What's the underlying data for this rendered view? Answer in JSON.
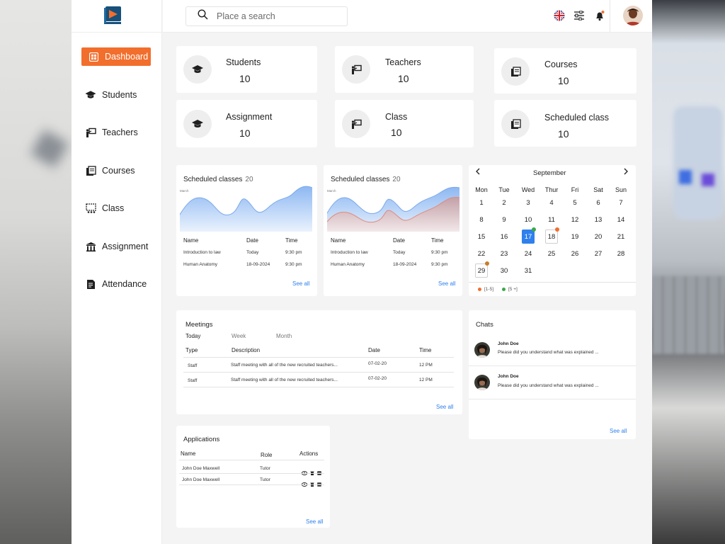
{
  "colors": {
    "accent": "#f26e2d",
    "link": "#2f80ed",
    "series_blue": "#8db8f2",
    "series_red": "#e2a39a"
  },
  "sidebar": {
    "items": [
      {
        "label": "Dashboard",
        "icon": "grid-icon",
        "active": true
      },
      {
        "label": "Students",
        "icon": "graduation-cap-icon"
      },
      {
        "label": "Teachers",
        "icon": "teacher-board-icon"
      },
      {
        "label": "Courses",
        "icon": "books-icon"
      },
      {
        "label": "Class",
        "icon": "classroom-icon"
      },
      {
        "label": "Assignment",
        "icon": "building-icon"
      },
      {
        "label": "Attendance",
        "icon": "document-icon"
      }
    ]
  },
  "topbar": {
    "search_placeholder": "Place a search",
    "icons": [
      "uk-flag-icon",
      "sliders-icon",
      "bell-icon",
      "user-avatar"
    ]
  },
  "stats": [
    {
      "label": "Students",
      "value": "10",
      "icon": "graduation-cap-icon"
    },
    {
      "label": "Teachers",
      "value": "10",
      "icon": "teacher-board-icon"
    },
    {
      "label": "Courses",
      "value": "10",
      "icon": "books-icon"
    },
    {
      "label": "Assignment",
      "value": "10",
      "icon": "graduation-cap-icon"
    },
    {
      "label": "Class",
      "value": "10",
      "icon": "teacher-board-icon"
    },
    {
      "label": "Scheduled class",
      "value": "10",
      "icon": "books-icon"
    }
  ],
  "scheduled": [
    {
      "title": "Scheduled classes",
      "count": "20",
      "month": "March",
      "headers": [
        "Name",
        "Date",
        "Time"
      ],
      "rows": [
        [
          "Introduction to law",
          "Today",
          "9:30 pm"
        ],
        [
          "Human Anatomy",
          "18-09-2024",
          "9:30 pm"
        ]
      ],
      "see_all": "See all"
    },
    {
      "title": "Scheduled classes",
      "count": "20",
      "month": "March",
      "headers": [
        "Name",
        "Date",
        "Time"
      ],
      "rows": [
        [
          "Introduction to law",
          "Today",
          "9:30 pm"
        ],
        [
          "Human Anatomy",
          "18-09-2024",
          "9:30 pm"
        ]
      ],
      "see_all": "See all"
    }
  ],
  "calendar": {
    "month": "September",
    "dow": [
      "Mon",
      "Tue",
      "Wed",
      "Thur",
      "Fri",
      "Sat",
      "Sun"
    ],
    "weeks": [
      [
        "1",
        "2",
        "3",
        "4",
        "5",
        "6",
        "7"
      ],
      [
        "8",
        "9",
        "10",
        "11",
        "12",
        "13",
        "14"
      ],
      [
        "15",
        "16",
        "17",
        "18",
        "19",
        "20",
        "21"
      ],
      [
        "22",
        "23",
        "24",
        "25",
        "26",
        "27",
        "28"
      ],
      [
        "29",
        "30",
        "31",
        "",
        "",
        "",
        ""
      ]
    ],
    "today": "17",
    "marked": [
      "18",
      "29"
    ],
    "legend": [
      {
        "label": "[1-5]",
        "color": "#f26e2d"
      },
      {
        "label": "[5 +]",
        "color": "#3aa84a"
      }
    ]
  },
  "meetings": {
    "title": "Meetings",
    "tabs": [
      "Today",
      "Week",
      "Month"
    ],
    "headers": [
      "Type",
      "Description",
      "Date",
      "Time"
    ],
    "rows": [
      [
        "Staff",
        "Staff meeting with all of the new recruited teachers...",
        "07-02-20",
        "12 PM"
      ],
      [
        "Staff",
        "Staff meeting with all of the new recruited teachers...",
        "07-02-20",
        "12 PM"
      ]
    ],
    "see_all": "See all"
  },
  "chats": {
    "title": "Chats",
    "items": [
      {
        "name": "John Doe",
        "message": "Please did you understand what was explained ..."
      },
      {
        "name": "John Doe",
        "message": "Please did you understand what was explained ..."
      }
    ],
    "see_all": "See all"
  },
  "applications": {
    "title": "Applications",
    "headers": [
      "Name",
      "Role",
      "Actions"
    ],
    "rows": [
      [
        "John Doe Maxwell",
        "Tutor"
      ],
      [
        "John Doe Maxwell",
        "Tutor"
      ]
    ],
    "action_icons": [
      "eye-icon",
      "trash-icon",
      "archive-icon"
    ],
    "see_all": "See all"
  }
}
